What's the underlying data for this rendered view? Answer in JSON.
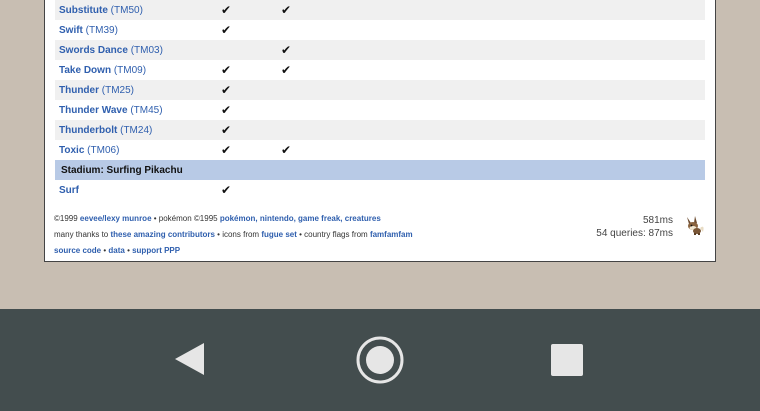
{
  "rows": [
    {
      "name": "Substitute",
      "tm": "(TM50)",
      "c1": "✔",
      "c2": "✔"
    },
    {
      "name": "Swift",
      "tm": "(TM39)",
      "c1": "✔",
      "c2": ""
    },
    {
      "name": "Swords Dance",
      "tm": "(TM03)",
      "c1": "",
      "c2": "✔"
    },
    {
      "name": "Take Down",
      "tm": "(TM09)",
      "c1": "✔",
      "c2": "✔"
    },
    {
      "name": "Thunder",
      "tm": "(TM25)",
      "c1": "✔",
      "c2": ""
    },
    {
      "name": "Thunder Wave",
      "tm": "(TM45)",
      "c1": "✔",
      "c2": ""
    },
    {
      "name": "Thunderbolt",
      "tm": "(TM24)",
      "c1": "✔",
      "c2": ""
    },
    {
      "name": "Toxic",
      "tm": "(TM06)",
      "c1": "✔",
      "c2": "✔"
    }
  ],
  "section": {
    "title": "Stadium: Surfing Pikachu",
    "rows": [
      {
        "name": "Surf",
        "c1": "✔"
      }
    ]
  },
  "footer": {
    "line1": {
      "prefix": "©1999 ",
      "author": "eevee/lexy munroe",
      "mid": " • pokémon ©1995 ",
      "owners": "pokémon, nintendo, game freak, creatures"
    },
    "line2": {
      "prefix": "many thanks to ",
      "contributors": "these amazing contributors",
      "icons_text": " • icons from ",
      "fugue": "fugue set",
      "flags_text": " • country flags from ",
      "famfamfam": "famfamfam"
    },
    "line3": {
      "source": "source code",
      "sep1": " • ",
      "data": "data",
      "sep2": " • ",
      "support": "support PPP"
    }
  },
  "stats": {
    "time": "581ms",
    "queries": "54 queries: 87ms"
  },
  "icons": {
    "mascot": "eevee-sprite-icon",
    "back": "back-triangle-icon",
    "home": "home-circle-icon",
    "recents": "recents-square-icon"
  },
  "colors": {
    "link": "#2f5fae",
    "section_bg": "#b8cae6",
    "navbar": "#434d4e",
    "backdrop": "#c8beb2"
  }
}
